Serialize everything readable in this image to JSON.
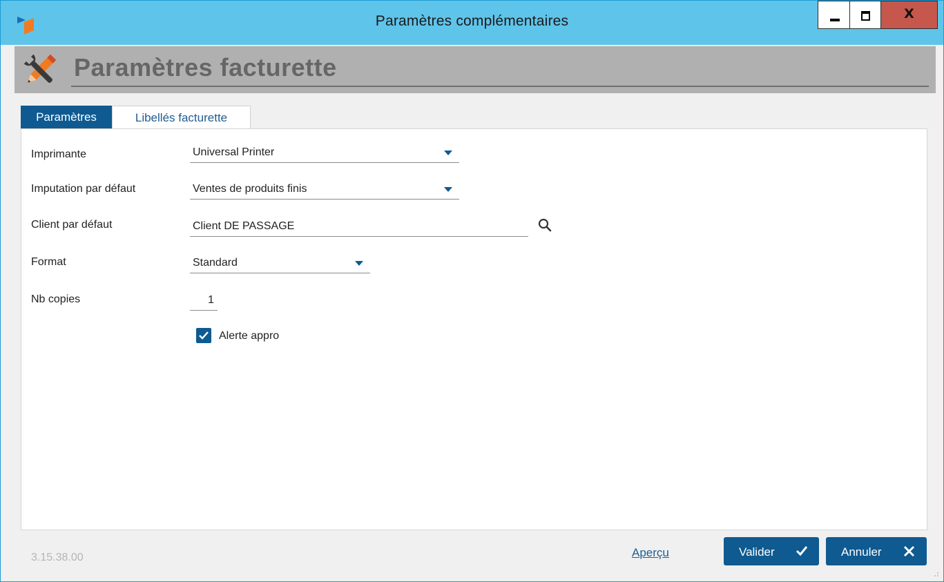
{
  "window": {
    "title": "Paramètres complémentaires",
    "controls": {
      "minimize": "minimize",
      "maximize": "maximize",
      "close": "X"
    }
  },
  "header": {
    "title": "Paramètres facturette"
  },
  "tabs": [
    {
      "label": "Paramètres",
      "active": true
    },
    {
      "label": "Libellés facturette",
      "active": false
    }
  ],
  "form": {
    "imprimante": {
      "label": "Imprimante",
      "value": "Universal Printer"
    },
    "imputation": {
      "label": "Imputation par défaut",
      "value": "Ventes de produits finis"
    },
    "client": {
      "label": "Client par défaut",
      "value": "Client DE PASSAGE"
    },
    "format": {
      "label": "Format",
      "value": "Standard"
    },
    "copies": {
      "label": "Nb copies",
      "value": "1"
    },
    "alerte": {
      "label": "Alerte appro",
      "checked": true
    }
  },
  "footer": {
    "version": "3.15.38.00",
    "apercu": "Aperçu",
    "valider": "Valider",
    "annuler": "Annuler"
  },
  "colors": {
    "titlebar": "#5fc4ea",
    "accent": "#0e5a91",
    "close": "#c6574c",
    "header": "#b0b0b0"
  }
}
